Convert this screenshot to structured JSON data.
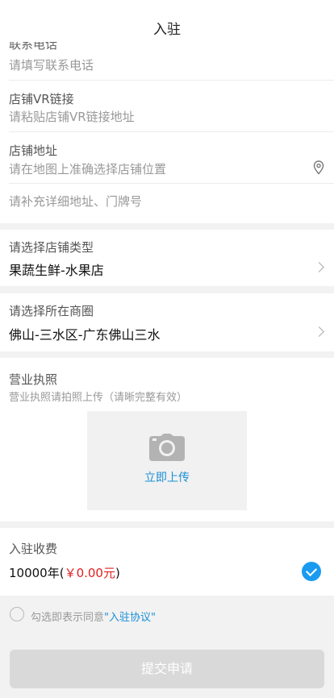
{
  "header": {
    "title": "入驻"
  },
  "form": {
    "phone_label_partial": "联系电话",
    "phone_placeholder": "请填写联系电话",
    "vr_label": "店铺VR链接",
    "vr_placeholder": "请粘贴店铺VR链接地址",
    "address_label": "店铺地址",
    "address_placeholder": "请在地图上准确选择店铺位置",
    "address_detail_placeholder": "请补充详细地址、门牌号",
    "store_type_label": "请选择店铺类型",
    "store_type_value": "果蔬生鲜-水果店",
    "district_label": "请选择所在商圈",
    "district_value": "佛山-三水区-广东佛山三水",
    "license_label": "营业执照",
    "license_hint": "营业执照请拍照上传（请晰完整有效）",
    "upload_label": "立即上传",
    "fee_label": "入驻收费",
    "fee_prefix": "10000年(",
    "fee_amount": "￥0.00元",
    "fee_suffix": ")",
    "agree_text": "勾选即表示同意",
    "agree_link": "\"入驻协议\"",
    "submit_label": "提交申请"
  },
  "icons": {
    "location": "location-pin-icon",
    "chevron": "chevron-right-icon",
    "camera": "camera-icon",
    "check": "check-circle-icon"
  },
  "colors": {
    "accent": "#1a9bf0",
    "price": "#e02020",
    "disabled": "#d9d9d9"
  }
}
